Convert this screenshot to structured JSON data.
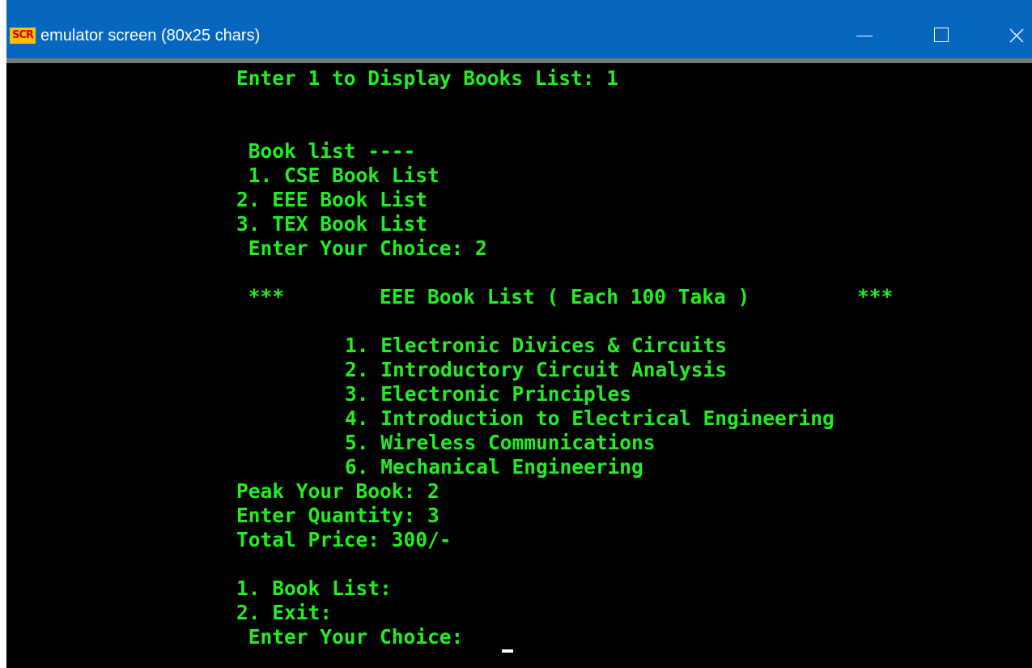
{
  "window": {
    "app_icon_text": "SCR",
    "title": "emulator screen (80x25 chars)",
    "controls": {
      "minimize_icon": "minimize-icon",
      "maximize_icon": "maximize-icon",
      "close_icon": "close-icon"
    }
  },
  "colors": {
    "titlebar": "#0767bf",
    "terminal_background": "#000000",
    "terminal_text": "#22ee22"
  },
  "console": {
    "prompt_display": "Enter 1 to Display Books List: 1",
    "menu_header": " Book list ----",
    "menu_item_1": " 1. CSE Book List",
    "menu_item_2": "2. EEE Book List",
    "menu_item_3": "3. TEX Book List",
    "choice_prompt_1": " Enter Your Choice: 2",
    "list_header": " ***        EEE Book List ( Each 100 Taka )         ***",
    "books": [
      "1. Electronic Divices & Circuits",
      "2. Introductory Circuit Analysis",
      "3. Electronic Principles",
      "4. Introduction to Electrical Engineering",
      "5. Wireless Communications",
      "6. Mechanical Engineering"
    ],
    "peak_book": "Peak Your Book: 2",
    "quantity": "Enter Quantity: 3",
    "total_price": "Total Price: 300/-",
    "final_menu_1": "1. Book List:",
    "final_menu_2": "2. Exit:",
    "choice_prompt_2": " Enter Your Choice: "
  }
}
